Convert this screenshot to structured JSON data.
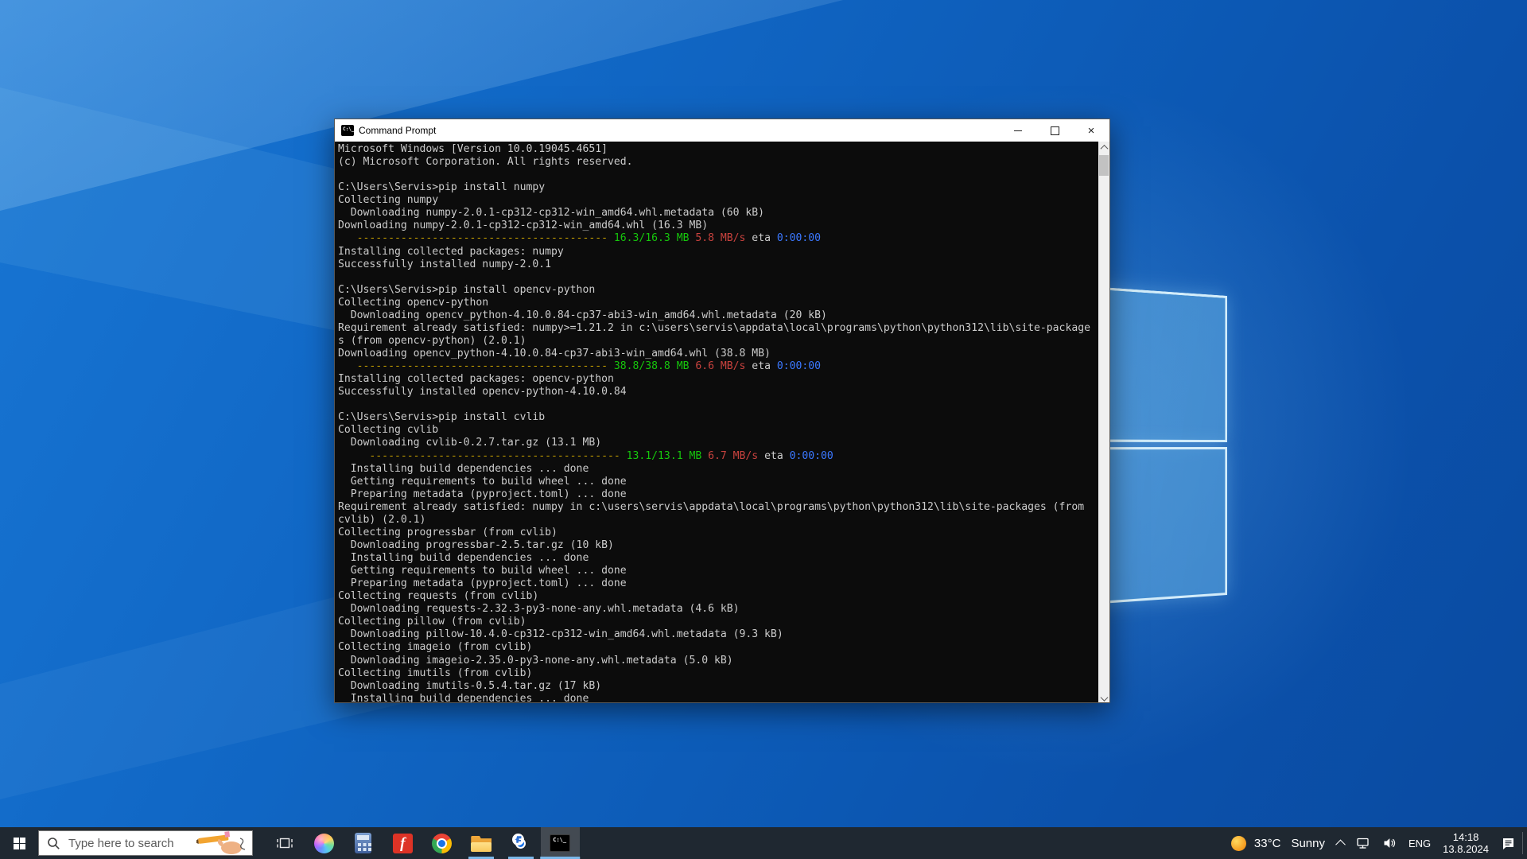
{
  "window": {
    "title": "Command Prompt",
    "icon_glyph": "C:\\_",
    "close_glyph": "×"
  },
  "console": {
    "colors": {
      "default": "#cccccc",
      "yellow": "#c19c00",
      "green": "#16c60c",
      "red": "#c8423e",
      "blue": "#3b78ff"
    },
    "lines": [
      "Microsoft Windows [Version 10.0.19045.4651]",
      "(c) Microsoft Corporation. All rights reserved.",
      "",
      "C:\\Users\\Servis>pip install numpy",
      "Collecting numpy",
      "  Downloading numpy-2.0.1-cp312-cp312-win_amd64.whl.metadata (60 kB)",
      "Downloading numpy-2.0.1-cp312-cp312-win_amd64.whl (16.3 MB)",
      [
        [
          "   ----------------------------------------",
          "yellow"
        ],
        [
          " 16.3/16.3 MB",
          "green"
        ],
        [
          " 5.8 MB/s",
          "red"
        ],
        [
          " eta",
          "default"
        ],
        [
          " 0:00:00",
          "blue"
        ]
      ],
      "Installing collected packages: numpy",
      "Successfully installed numpy-2.0.1",
      "",
      "C:\\Users\\Servis>pip install opencv-python",
      "Collecting opencv-python",
      "  Downloading opencv_python-4.10.0.84-cp37-abi3-win_amd64.whl.metadata (20 kB)",
      "Requirement already satisfied: numpy>=1.21.2 in c:\\users\\servis\\appdata\\local\\programs\\python\\python312\\lib\\site-package",
      "s (from opencv-python) (2.0.1)",
      "Downloading opencv_python-4.10.0.84-cp37-abi3-win_amd64.whl (38.8 MB)",
      [
        [
          "   ----------------------------------------",
          "yellow"
        ],
        [
          " 38.8/38.8 MB",
          "green"
        ],
        [
          " 6.6 MB/s",
          "red"
        ],
        [
          " eta",
          "default"
        ],
        [
          " 0:00:00",
          "blue"
        ]
      ],
      "Installing collected packages: opencv-python",
      "Successfully installed opencv-python-4.10.0.84",
      "",
      "C:\\Users\\Servis>pip install cvlib",
      "Collecting cvlib",
      "  Downloading cvlib-0.2.7.tar.gz (13.1 MB)",
      [
        [
          "     ----------------------------------------",
          "yellow"
        ],
        [
          " 13.1/13.1 MB",
          "green"
        ],
        [
          " 6.7 MB/s",
          "red"
        ],
        [
          " eta",
          "default"
        ],
        [
          " 0:00:00",
          "blue"
        ]
      ],
      "  Installing build dependencies ... done",
      "  Getting requirements to build wheel ... done",
      "  Preparing metadata (pyproject.toml) ... done",
      "Requirement already satisfied: numpy in c:\\users\\servis\\appdata\\local\\programs\\python\\python312\\lib\\site-packages (from",
      "cvlib) (2.0.1)",
      "Collecting progressbar (from cvlib)",
      "  Downloading progressbar-2.5.tar.gz (10 kB)",
      "  Installing build dependencies ... done",
      "  Getting requirements to build wheel ... done",
      "  Preparing metadata (pyproject.toml) ... done",
      "Collecting requests (from cvlib)",
      "  Downloading requests-2.32.3-py3-none-any.whl.metadata (4.6 kB)",
      "Collecting pillow (from cvlib)",
      "  Downloading pillow-10.4.0-cp312-cp312-win_amd64.whl.metadata (9.3 kB)",
      "Collecting imageio (from cvlib)",
      "  Downloading imageio-2.35.0-py3-none-any.whl.metadata (5.0 kB)",
      "Collecting imutils (from cvlib)",
      "  Downloading imutils-0.5.4.tar.gz (17 kB)",
      "  Installing build dependencies ... done"
    ]
  },
  "taskbar": {
    "search_placeholder": "Type here to search",
    "cmd_icon_glyph": "C:\\_",
    "red_app_glyph": "f"
  },
  "tray": {
    "temperature": "33°C",
    "condition": "Sunny",
    "language": "ENG",
    "time": "14:18",
    "date": "13.8.2024"
  }
}
